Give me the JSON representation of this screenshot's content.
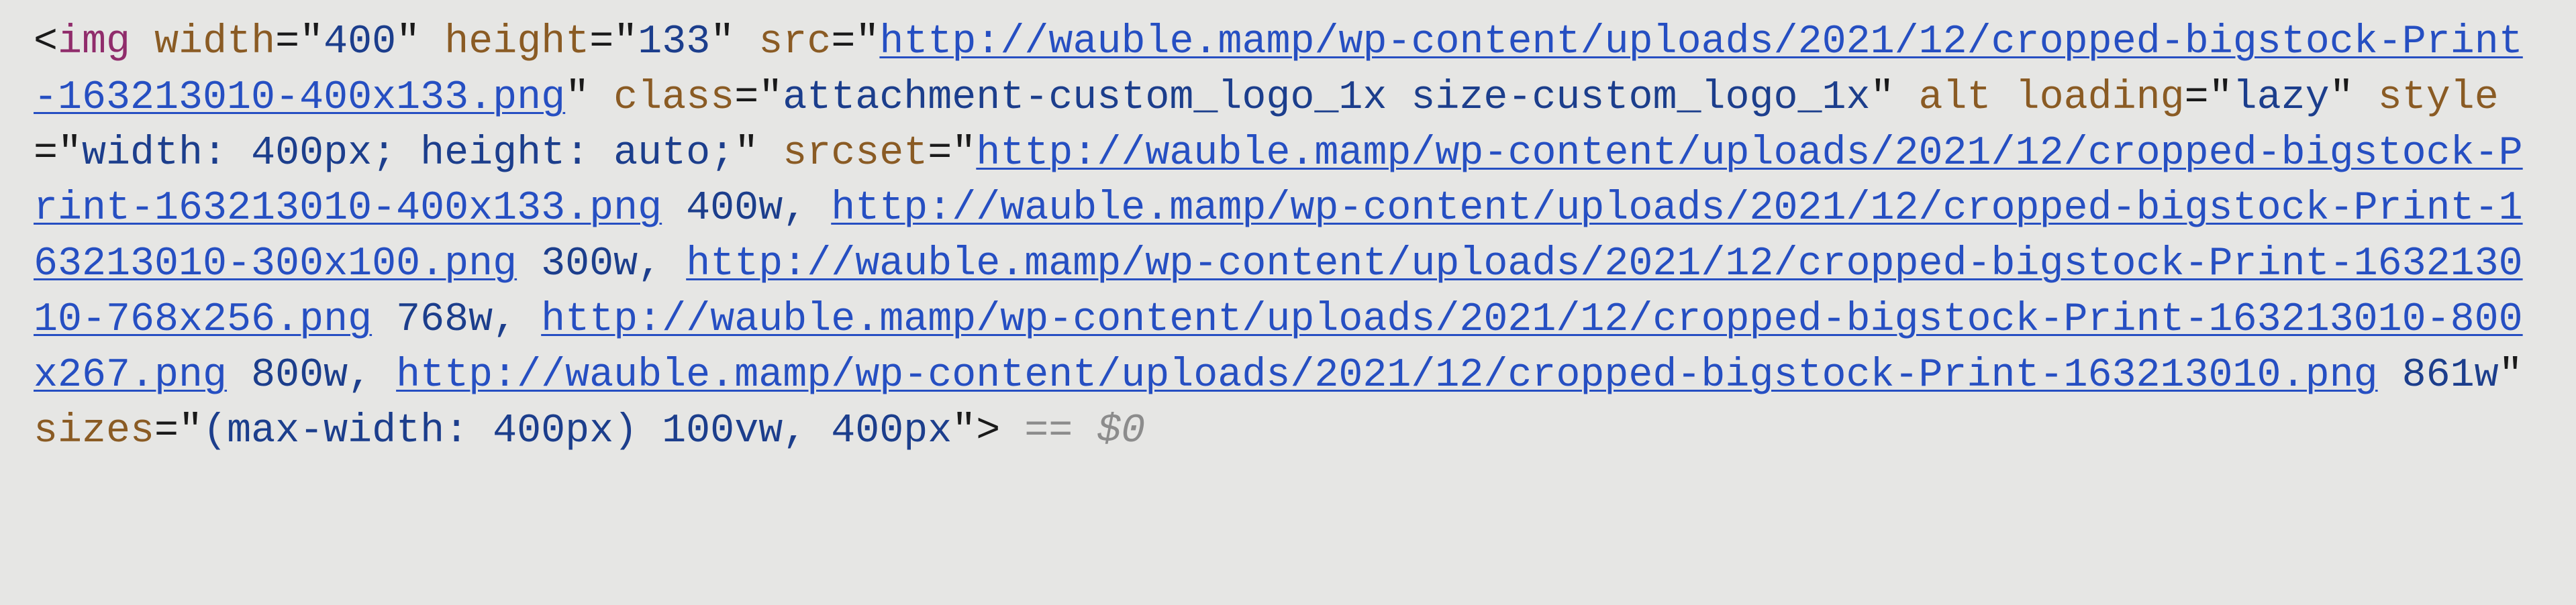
{
  "code": {
    "tag_name": "img",
    "attrs": {
      "width": {
        "name": "width",
        "value": "400"
      },
      "height": {
        "name": "height",
        "value": "133"
      },
      "src": {
        "name": "src",
        "url": "http://wauble.mamp/wp-content/uploads/2021/12/cropped-bigstock-Print-163213010-400x133.png"
      },
      "class": {
        "name": "class",
        "value": "attachment-custom_logo_1x size-custom_logo_1x"
      },
      "alt": {
        "name": "alt"
      },
      "loading": {
        "name": "loading",
        "value": "lazy"
      },
      "style": {
        "name": "style",
        "value": "width: 400px; height: auto;"
      },
      "srcset": {
        "name": "srcset",
        "items": [
          {
            "url": "http://wauble.mamp/wp-content/uploads/2021/12/cropped-bigstock-Print-163213010-400x133.png",
            "descriptor": "400w"
          },
          {
            "url": "http://wauble.mamp/wp-content/uploads/2021/12/cropped-bigstock-Print-163213010-300x100.png",
            "descriptor": "300w"
          },
          {
            "url": "http://wauble.mamp/wp-content/uploads/2021/12/cropped-bigstock-Print-163213010-768x256.png",
            "descriptor": "768w"
          },
          {
            "url": "http://wauble.mamp/wp-content/uploads/2021/12/cropped-bigstock-Print-163213010-800x267.png",
            "descriptor": "800w"
          },
          {
            "url": "http://wauble.mamp/wp-content/uploads/2021/12/cropped-bigstock-Print-163213010.png",
            "descriptor": "861w"
          }
        ]
      },
      "sizes": {
        "name": "sizes",
        "value": "(max-width: 400px) 100vw, 400px"
      }
    },
    "selected_suffix": " == $0"
  },
  "glue": {
    "lt": "<",
    "gt": ">",
    "eq": "=",
    "q": "\"",
    "sp": " ",
    "comma_sp": ", "
  }
}
